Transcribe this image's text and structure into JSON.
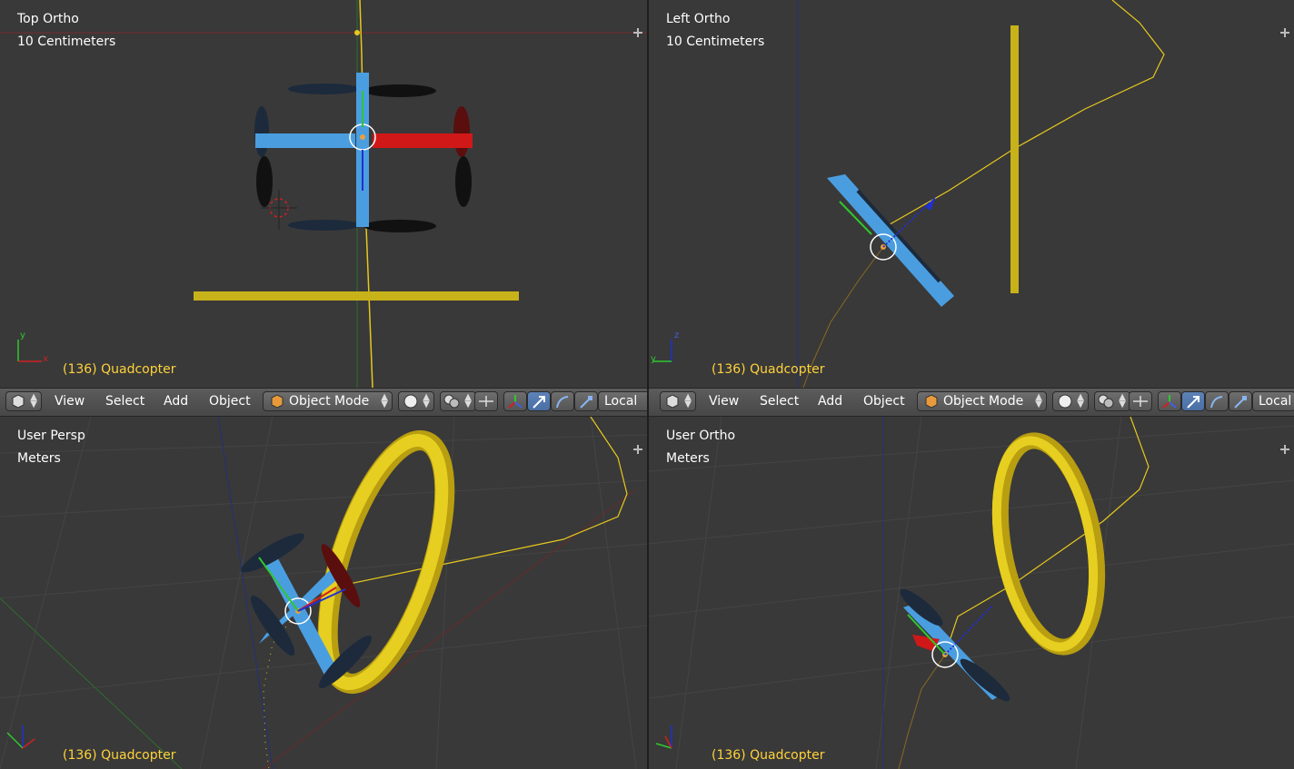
{
  "viewports": {
    "top_left": {
      "view": "Top Ortho",
      "scale": "10 Centimeters",
      "object": "(136) Quadcopter"
    },
    "top_right": {
      "view": "Left Ortho",
      "scale": "10 Centimeters",
      "object": "(136) Quadcopter"
    },
    "bottom_left": {
      "view": "User Persp",
      "scale": "Meters",
      "object": "(136) Quadcopter"
    },
    "bottom_right": {
      "view": "User Ortho",
      "scale": "Meters",
      "object": "(136) Quadcopter"
    }
  },
  "header": {
    "menu": [
      "View",
      "Select",
      "Add",
      "Object"
    ],
    "mode": "Object Mode",
    "orientation": "Local"
  },
  "colors": {
    "background": "#393939",
    "accent_yellow": "#d8c21a",
    "frame_blue": "#4a9ee0",
    "selected_blue": "#5d82b8"
  },
  "icons": [
    "cube-icon",
    "mode-cube-icon",
    "sphere-shading-icon",
    "pivot-icon",
    "manipulator-icon",
    "translate-icon",
    "rotate-icon",
    "scale-icon"
  ]
}
